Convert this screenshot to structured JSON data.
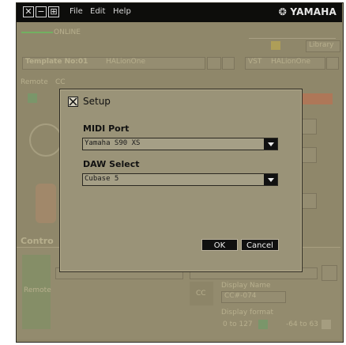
{
  "menu": {
    "file": "File",
    "edit": "Edit",
    "help": "Help"
  },
  "brand": "YAMAHA",
  "background": {
    "online": "ONLINE",
    "library": "Library",
    "template": "Template No:01",
    "template_name": "HALionOne",
    "vst": "VST",
    "vst_value": "HALionOne",
    "remote": "Remote",
    "cc": "CC",
    "control": "Contro",
    "remote_label": "Remote",
    "cc_label": "CC",
    "display_name": "Display Name",
    "display_name_value": "CC#-074",
    "display_format": "Display format",
    "range1": "0 to 127",
    "range2": "-64 to 63"
  },
  "dialog": {
    "title": "Setup",
    "midi_port_label": "MIDI Port",
    "midi_port_value": "Yamaha S90 XS",
    "daw_label": "DAW Select",
    "daw_value": "Cubase 5",
    "ok_label": "OK",
    "cancel_label": "Cancel"
  }
}
